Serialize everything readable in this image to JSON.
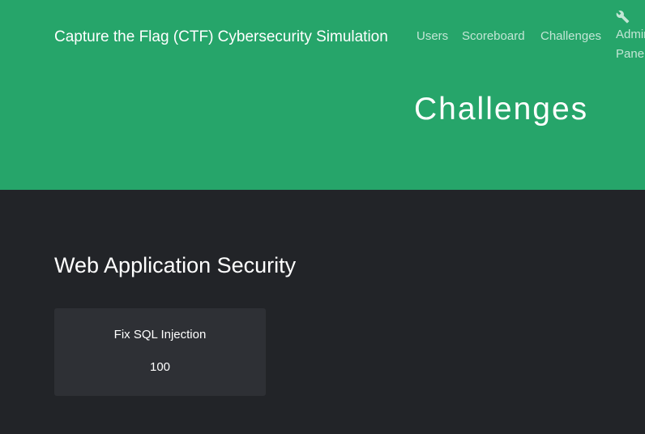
{
  "navbar": {
    "brand": "Capture the Flag (CTF) Cybersecurity Simulation",
    "links": [
      {
        "label": "Users"
      },
      {
        "label": "Scoreboard"
      },
      {
        "label": "Challenges"
      }
    ],
    "admin": {
      "label": "Admin Panel",
      "icon": "wrench-icon"
    }
  },
  "hero": {
    "title": "Challenges"
  },
  "categories": [
    {
      "name": "Web Application Security",
      "challenges": [
        {
          "name": "Fix SQL Injection",
          "value": "100"
        }
      ]
    }
  ],
  "colors": {
    "accent": "#26a56a",
    "background": "#222428",
    "card": "#2e3035"
  }
}
